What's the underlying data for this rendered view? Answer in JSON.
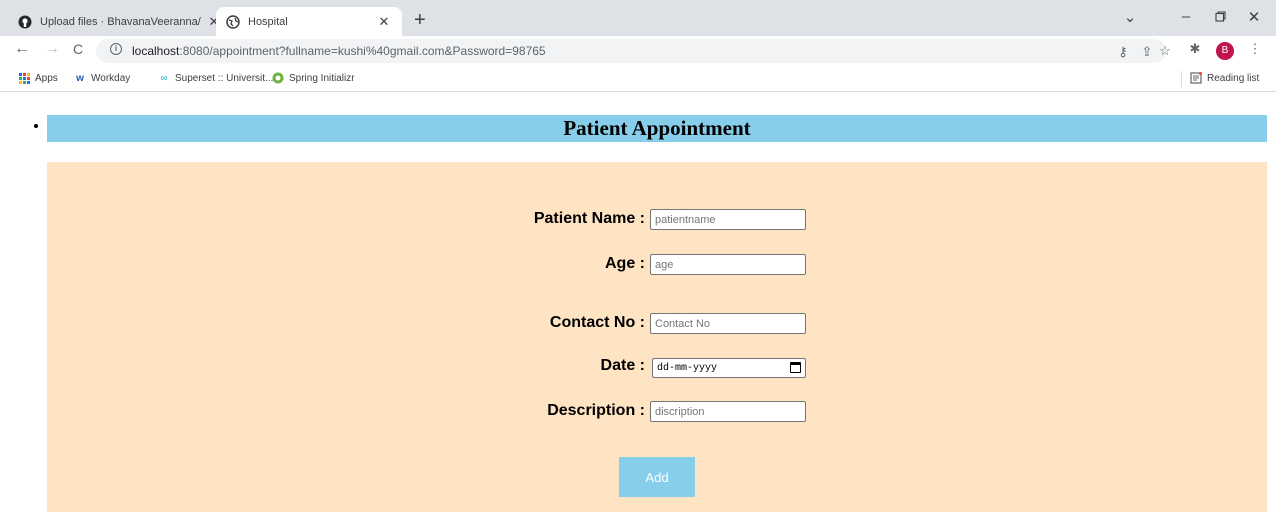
{
  "browser": {
    "tabs": [
      {
        "title": "Upload files · BhavanaVeeranna/",
        "active": false
      },
      {
        "title": "Hospital",
        "active": true
      }
    ],
    "new_tab_glyph": "+",
    "url_host": "localhost",
    "url_rest": ":8080/appointment?fullname=kushi%40gmail.com&Password=98765",
    "profile_initial": "B",
    "bookmarks": [
      {
        "label": "Apps",
        "icon": "apps-grid-icon"
      },
      {
        "label": "Workday",
        "icon": "workday-icon"
      },
      {
        "label": "Superset :: Universit...",
        "icon": "superset-icon"
      },
      {
        "label": "Spring Initializr",
        "icon": "spring-icon"
      }
    ],
    "reading_list": "Reading list"
  },
  "page": {
    "title": "Patient Appointment",
    "colors": {
      "title_bar": "#87ceeb",
      "form_bg": "#ffe4c4",
      "button": "#87ceeb"
    },
    "fields": {
      "patient_name": {
        "label": "Patient Name :",
        "placeholder": "patientname"
      },
      "age": {
        "label": "Age :",
        "placeholder": "age"
      },
      "contact_no": {
        "label": "Contact No :",
        "placeholder": "Contact No"
      },
      "date": {
        "label": "Date :",
        "placeholder": "dd-mm-yyyy"
      },
      "description": {
        "label": "Description :",
        "placeholder": "discription"
      }
    },
    "submit_label": "Add"
  }
}
